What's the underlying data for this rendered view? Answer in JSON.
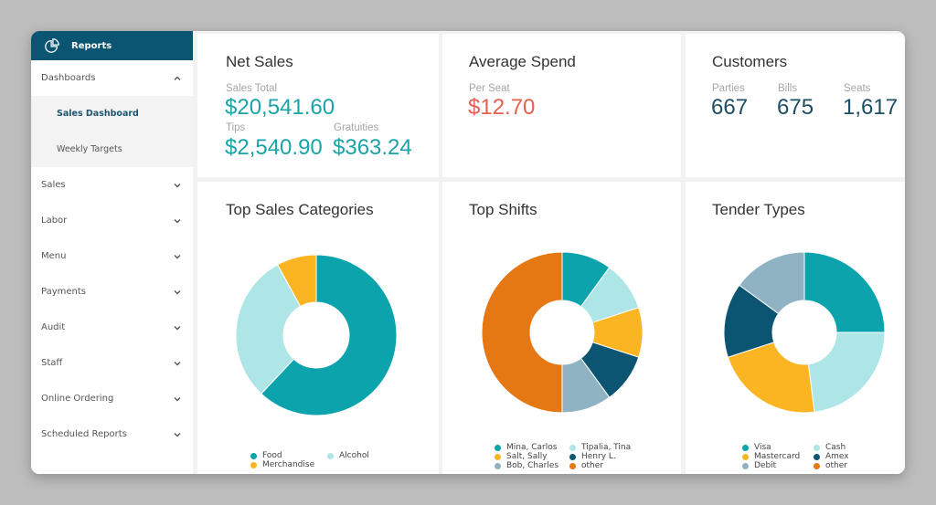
{
  "sidebar": {
    "header": {
      "label": "Reports",
      "icon": "pie-chart-icon"
    },
    "items": [
      {
        "label": "Dashboards",
        "expanded": true,
        "children": [
          {
            "label": "Sales Dashboard",
            "active": true
          },
          {
            "label": "Weekly Targets",
            "active": false
          }
        ]
      },
      {
        "label": "Sales"
      },
      {
        "label": "Labor"
      },
      {
        "label": "Menu"
      },
      {
        "label": "Payments"
      },
      {
        "label": "Audit"
      },
      {
        "label": "Staff"
      },
      {
        "label": "Online Ordering"
      },
      {
        "label": "Scheduled Reports"
      }
    ]
  },
  "net_sales": {
    "title": "Net Sales",
    "sales_total_label": "Sales Total",
    "sales_total": "$20,541.60",
    "tips_label": "Tips",
    "tips": "$2,540.90",
    "gratuities_label": "Gratuities",
    "gratuities": "$363.24"
  },
  "average_spend": {
    "title": "Average Spend",
    "per_seat_label": "Per Seat",
    "per_seat": "$12.70"
  },
  "customers": {
    "title": "Customers",
    "parties_label": "Parties",
    "parties": "667",
    "bills_label": "Bills",
    "bills": "675",
    "seats_label": "Seats",
    "seats": "1,617"
  },
  "colors": {
    "teal": "#0ba3ac",
    "light_teal": "#aee6e8",
    "yellow": "#fbb523",
    "navy": "#0b5573",
    "grey_blue": "#8fb3c2",
    "orange": "#e67814",
    "accent_red": "#e5604f",
    "header_bg": "#0b5573"
  },
  "chart_data": [
    {
      "type": "pie",
      "title": "Top Sales Categories",
      "categories": [
        "Food",
        "Alcohol",
        "Merchandise"
      ],
      "values": [
        0.62,
        0.3,
        0.08
      ],
      "colors": [
        "#0ba3ac",
        "#aee6e8",
        "#fbb523"
      ],
      "legend": "bottom"
    },
    {
      "type": "pie",
      "title": "Top Shifts",
      "categories": [
        "Mina, Carlos",
        "Tipalia, Tina",
        "Salt, Sally",
        "Henry L.",
        "Bob, Charles",
        "other"
      ],
      "values": [
        0.1,
        0.1,
        0.1,
        0.1,
        0.1,
        0.5
      ],
      "colors": [
        "#0ba3ac",
        "#aee6e8",
        "#fbb523",
        "#0b5573",
        "#8fb3c2",
        "#e67814"
      ],
      "legend": "bottom"
    },
    {
      "type": "pie",
      "title": "Tender Types",
      "categories": [
        "Visa",
        "Cash",
        "Mastercard",
        "Amex",
        "Debit",
        "other"
      ],
      "values": [
        0.25,
        0.23,
        0.22,
        0.15,
        0.15,
        0
      ],
      "colors": [
        "#0ba3ac",
        "#aee6e8",
        "#fbb523",
        "#0b5573",
        "#8fb3c2",
        "#e67814"
      ],
      "legend": "bottom"
    }
  ]
}
